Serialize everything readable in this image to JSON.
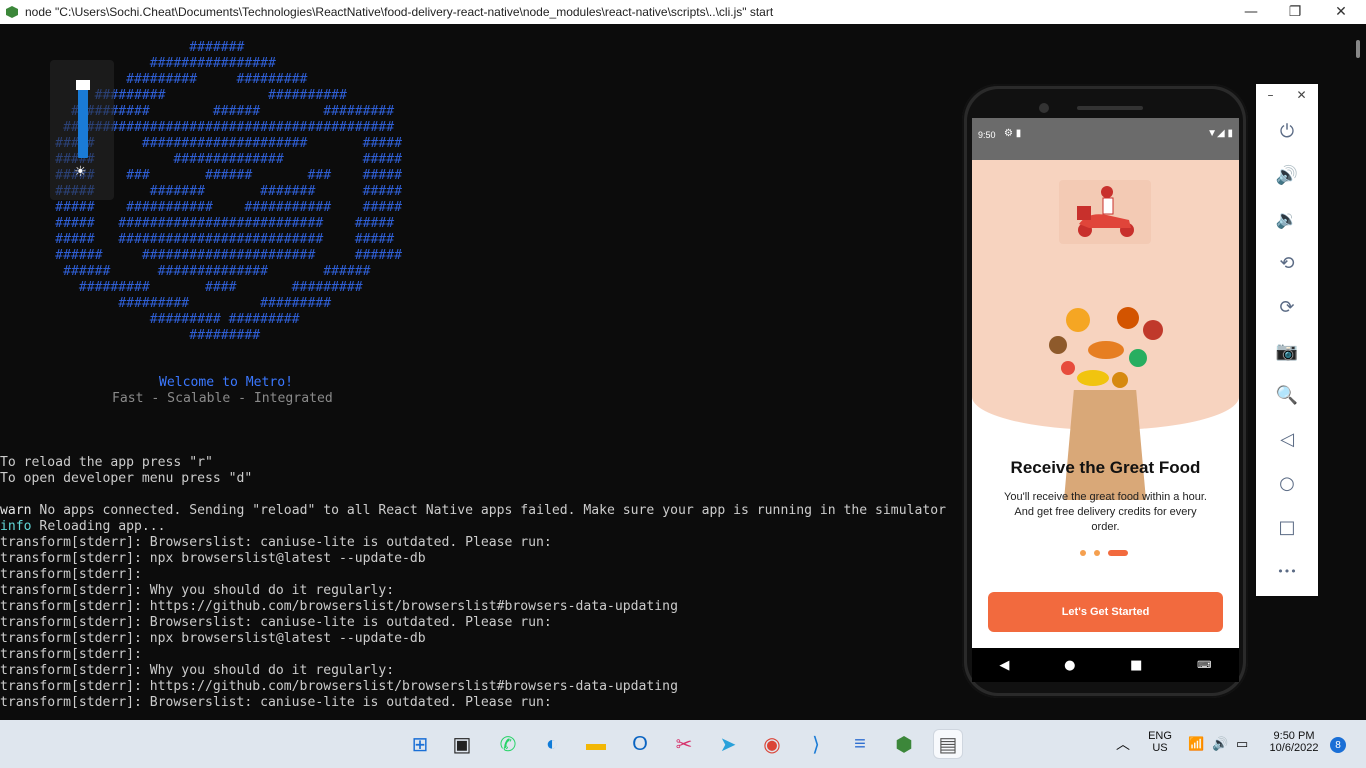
{
  "window": {
    "title": "node  \"C:\\Users\\Sochi.Cheat\\Documents\\Technologies\\ReactNative\\food-delivery-react-native\\node_modules\\react-native\\scripts\\..\\cli.js\" start",
    "minimize": "—",
    "restore": "❐",
    "close": "✕"
  },
  "terminal": {
    "logo": [
      "                        #######",
      "                   ################",
      "                #########     #########",
      "            #########             ##########",
      "         ##########        ######        #########",
      "        ##########################################",
      "       #####      #####################       #####",
      "       #####          ##############          #####",
      "       #####    ###       ######       ###    #####",
      "       #####       #######       #######      #####",
      "       #####    ###########    ###########    #####",
      "       #####   ##########################    #####",
      "       #####   ##########################    #####",
      "       ######     ######################     ######",
      "        ######      ##############       ######",
      "          #########       ####       #########",
      "               #########         #########",
      "                   ######### #########",
      "                        #########"
    ],
    "welcome": "Welcome to Metro!",
    "tagline": "Fast - Scalable - Integrated",
    "reload_hint": "To reload the app press \"r\"",
    "devmenu_hint": "To open developer menu press \"d\"",
    "warn_label": "warn",
    "warn_text": " No apps connected. Sending \"reload\" to all React Native apps failed. Make sure your app is running in the simulator",
    "info_label": "info",
    "info_text": " Reloading app...",
    "log_lines": [
      "transform[stderr]: Browserslist: caniuse-lite is outdated. Please run:",
      "transform[stderr]: npx browserslist@latest --update-db",
      "transform[stderr]:",
      "transform[stderr]: Why you should do it regularly:",
      "transform[stderr]: https://github.com/browserslist/browserslist#browsers-data-updating",
      "transform[stderr]: Browserslist: caniuse-lite is outdated. Please run:",
      "transform[stderr]: npx browserslist@latest --update-db",
      "transform[stderr]:",
      "transform[stderr]: Why you should do it regularly:",
      "transform[stderr]: https://github.com/browserslist/browserslist#browsers-data-updating",
      "transform[stderr]: Browserslist: caniuse-lite is outdated. Please run:"
    ]
  },
  "brightness": {
    "level": 0.95,
    "icon": "sun-icon"
  },
  "phone": {
    "status_time": "9:50",
    "status_left_icons": "⚙ ▮",
    "status_right_icons": "▼◢ ▮",
    "title": "Receive the Great Food",
    "body": "You'll receive the great food within a hour. And get free delivery credits for every order.",
    "cta": "Let's Get Started",
    "nav": {
      "back": "◀",
      "home": "●",
      "recents": "■",
      "keyboard": "⌨"
    },
    "page_indicator": {
      "total": 3,
      "active": 3
    }
  },
  "emulator_toolbar": {
    "minimize": "–",
    "close": "✕",
    "buttons": [
      {
        "name": "power-icon",
        "glyph": "⏻"
      },
      {
        "name": "volume-up-icon",
        "glyph": "🔊"
      },
      {
        "name": "volume-down-icon",
        "glyph": "🔉"
      },
      {
        "name": "rotate-left-icon",
        "glyph": "⟲"
      },
      {
        "name": "rotate-right-icon",
        "glyph": "⟳"
      },
      {
        "name": "camera-icon",
        "glyph": "📷"
      },
      {
        "name": "zoom-icon",
        "glyph": "🔍"
      },
      {
        "name": "back-icon",
        "glyph": "◁"
      },
      {
        "name": "home-icon",
        "glyph": "○"
      },
      {
        "name": "overview-icon",
        "glyph": "□"
      },
      {
        "name": "more-icon",
        "glyph": "•••"
      }
    ]
  },
  "taskbar": {
    "apps": [
      {
        "name": "start-icon",
        "glyph": "⊞",
        "color": "#1a6fd6"
      },
      {
        "name": "task-view-icon",
        "glyph": "▣",
        "color": "#222222"
      },
      {
        "name": "whatsapp-icon",
        "glyph": "✆",
        "color": "#25d366"
      },
      {
        "name": "edge-icon",
        "glyph": "◐",
        "color": "#0f7bd8"
      },
      {
        "name": "file-explorer-icon",
        "glyph": "▬",
        "color": "#f2b705"
      },
      {
        "name": "outlook-icon",
        "glyph": "O",
        "color": "#0a64c2"
      },
      {
        "name": "snipping-tool-icon",
        "glyph": "✂",
        "color": "#d6336c"
      },
      {
        "name": "telegram-icon",
        "glyph": "➤",
        "color": "#2aa1da"
      },
      {
        "name": "chrome-icon",
        "glyph": "◉",
        "color": "#db4437"
      },
      {
        "name": "vscode-icon",
        "glyph": "⟩",
        "color": "#1c7cd6"
      },
      {
        "name": "notepad-icon",
        "glyph": "≡",
        "color": "#2f6fd0"
      },
      {
        "name": "nodejs-icon",
        "glyph": "⬢",
        "color": "#3c873a"
      },
      {
        "name": "terminal-app-icon",
        "glyph": "▤",
        "color": "#555555"
      }
    ],
    "lang_line1": "ENG",
    "lang_line2": "US",
    "time": "9:50 PM",
    "date": "10/6/2022",
    "notifications": "8"
  }
}
